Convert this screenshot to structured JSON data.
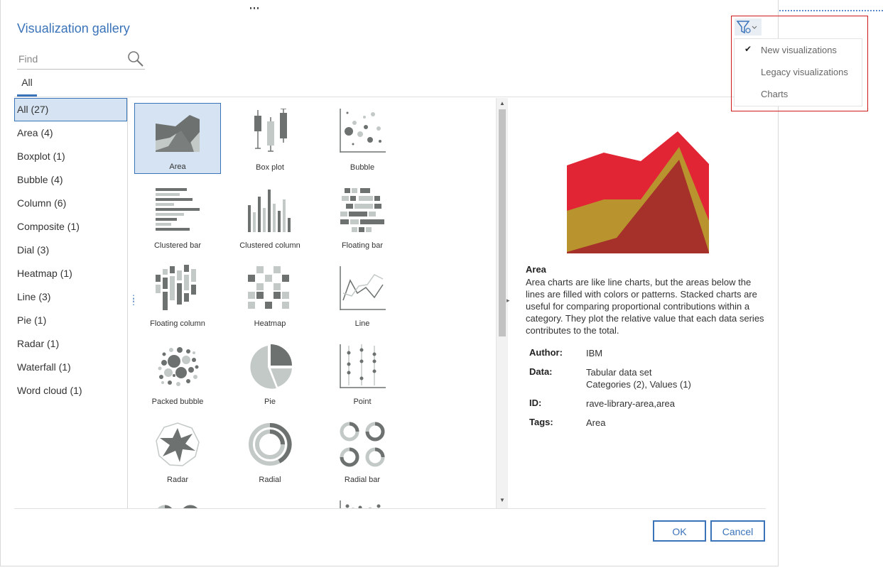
{
  "dialog": {
    "title": "Visualization gallery",
    "search_placeholder": "Find",
    "tab_all": "All"
  },
  "categories": [
    {
      "label": "All (27)"
    },
    {
      "label": "Area (4)"
    },
    {
      "label": "Boxplot (1)"
    },
    {
      "label": "Bubble (4)"
    },
    {
      "label": "Column (6)"
    },
    {
      "label": "Composite (1)"
    },
    {
      "label": "Dial (3)"
    },
    {
      "label": "Heatmap (1)"
    },
    {
      "label": "Line (3)"
    },
    {
      "label": "Pie (1)"
    },
    {
      "label": "Radar (1)"
    },
    {
      "label": "Waterfall (1)"
    },
    {
      "label": "Word cloud (1)"
    }
  ],
  "gallery": [
    {
      "label": "Area",
      "icon": "area-chart-icon"
    },
    {
      "label": "Box plot",
      "icon": "box-plot-icon"
    },
    {
      "label": "Bubble",
      "icon": "bubble-chart-icon"
    },
    {
      "label": "Clustered bar",
      "icon": "clustered-bar-icon"
    },
    {
      "label": "Clustered column",
      "icon": "clustered-column-icon"
    },
    {
      "label": "Floating bar",
      "icon": "floating-bar-icon"
    },
    {
      "label": "Floating column",
      "icon": "floating-column-icon"
    },
    {
      "label": "Heatmap",
      "icon": "heatmap-icon"
    },
    {
      "label": "Line",
      "icon": "line-chart-icon"
    },
    {
      "label": "Packed bubble",
      "icon": "packed-bubble-icon"
    },
    {
      "label": "Pie",
      "icon": "pie-chart-icon"
    },
    {
      "label": "Point",
      "icon": "point-chart-icon"
    },
    {
      "label": "Radar",
      "icon": "radar-chart-icon"
    },
    {
      "label": "Radial",
      "icon": "radial-chart-icon"
    },
    {
      "label": "Radial bar",
      "icon": "radial-bar-icon"
    }
  ],
  "detail": {
    "name": "Area",
    "description": "Area charts are like line charts, but the areas below the lines are filled with colors or patterns. Stacked charts are useful for comparing proportional contributions within a category. They plot the relative value that each data series contributes to the total.",
    "author_label": "Author:",
    "author": "IBM",
    "data_label": "Data:",
    "data_line1": "Tabular data set",
    "data_line2": "Categories (2),  Values (1)",
    "id_label": "ID:",
    "id": "rave-library-area,area",
    "tags_label": "Tags:",
    "tags": "Area",
    "preview_colors": [
      "#e12535",
      "#b9942e",
      "#a5312a"
    ]
  },
  "filter_menu": {
    "items": [
      {
        "label": "New visualizations",
        "checked": true
      },
      {
        "label": "Legacy visualizations",
        "checked": false
      },
      {
        "label": "Charts",
        "checked": false
      }
    ]
  },
  "buttons": {
    "ok": "OK",
    "cancel": "Cancel"
  },
  "colors": {
    "accent": "#3b73b9",
    "selection_bg": "#d6e3f2",
    "icon_dark": "#6d7270",
    "icon_light": "#c3c9c6",
    "highlight_border": "#d01a1a"
  }
}
